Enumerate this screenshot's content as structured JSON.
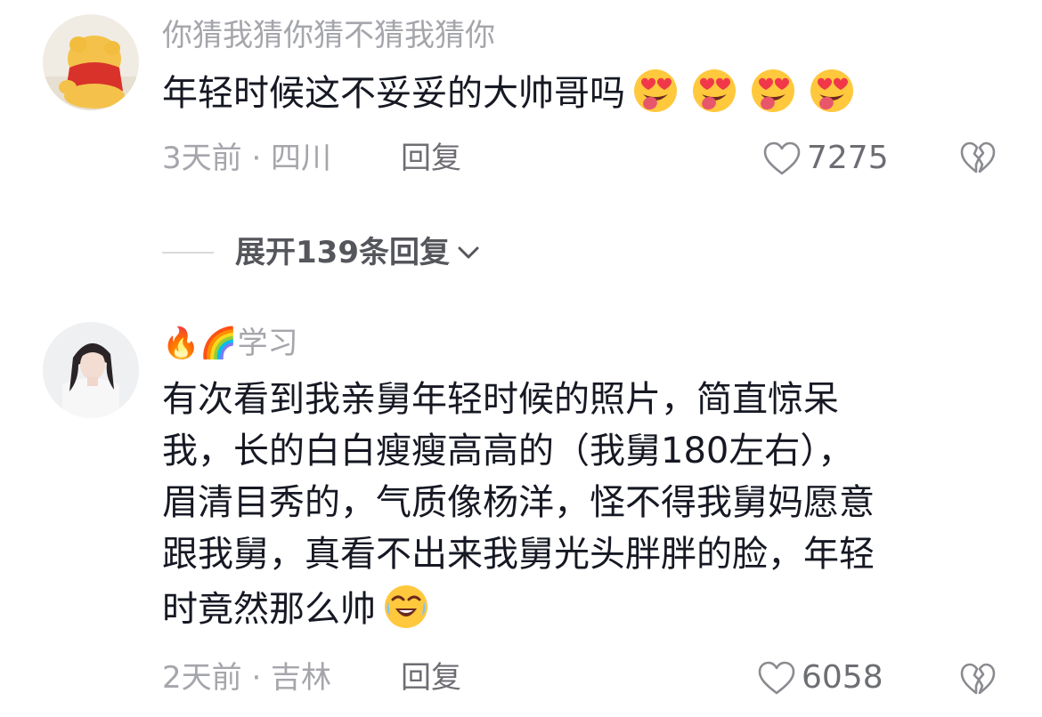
{
  "comments": [
    {
      "username": "你猜我猜你猜不猜我猜你",
      "username_emojis": "",
      "text_lines": [
        "年轻时候这不妥妥的大帅哥吗"
      ],
      "trailing_emojis": [
        "heart-eyes-tongue",
        "heart-eyes-tongue",
        "heart-eyes-tongue",
        "heart-eyes-tongue"
      ],
      "time_location": "3天前 · 四川",
      "reply_label": "回复",
      "like_count": "7275"
    },
    {
      "username": "学习",
      "username_emojis": "🔥🌈",
      "text_lines": [
        "有次看到我亲舅年轻时候的照片，简直惊呆",
        "我，长的白白瘦瘦高高的（我舅180左右），",
        "眉清目秀的，气质像杨洋，怪不得我舅妈愿意",
        "跟我舅，真看不出来我舅光头胖胖的脸，年轻",
        "时竟然那么帅"
      ],
      "trailing_emojis": [
        "crying-laughing"
      ],
      "time_location": "2天前 · 吉林",
      "reply_label": "回复",
      "like_count": "6058"
    }
  ],
  "expand_replies": {
    "label": "展开139条回复",
    "icon": "chevron-down-icon"
  },
  "colors": {
    "text": "#161823",
    "secondary": "#a5a6ab",
    "action": "#6d6e73",
    "emoji_face": "#ffc83d",
    "emoji_heart": "#f0384a",
    "emoji_tongue": "#e8566b"
  }
}
